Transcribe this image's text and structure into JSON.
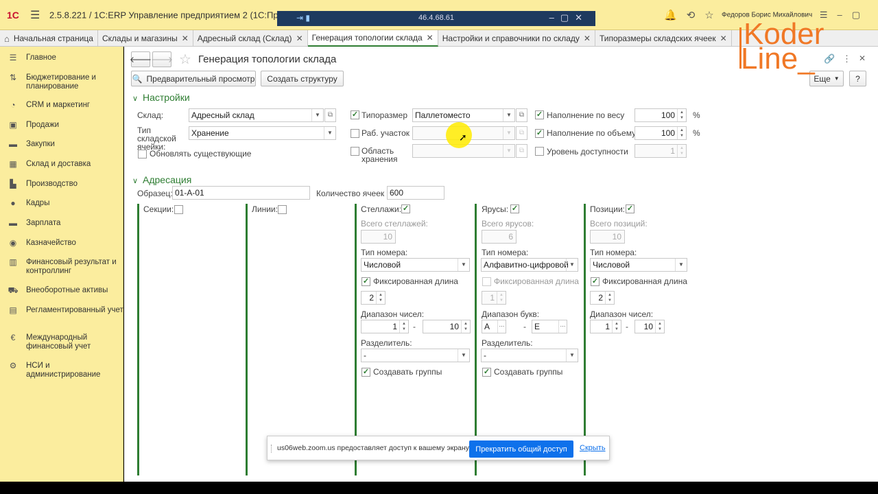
{
  "titlebar": {
    "logo": "1С",
    "title": "2.5.8.221 / 1С:ERP Управление предприятием 2  (1С:Предприятие)",
    "user": "Федоров Борис Михайлович",
    "zoom_ip": "46.4.68.61"
  },
  "tabs": [
    {
      "label": "Начальная страница"
    },
    {
      "label": "Склады и магазины"
    },
    {
      "label": "Адресный склад (Склад)"
    },
    {
      "label": "Генерация топологии склада"
    },
    {
      "label": "Настройки и справочники по складу"
    },
    {
      "label": "Типоразмеры складских ячеек"
    }
  ],
  "sidebar": {
    "items": [
      {
        "label": "Главное",
        "icon": "menu-icon"
      },
      {
        "label": "Бюджетирование и планирование",
        "icon": "budget-icon"
      },
      {
        "label": "CRM и маркетинг",
        "icon": "crm-icon"
      },
      {
        "label": "Продажи",
        "icon": "sales-icon"
      },
      {
        "label": "Закупки",
        "icon": "cart-icon"
      },
      {
        "label": "Склад и доставка",
        "icon": "warehouse-icon"
      },
      {
        "label": "Производство",
        "icon": "factory-icon"
      },
      {
        "label": "Кадры",
        "icon": "person-icon"
      },
      {
        "label": "Зарплата",
        "icon": "salary-icon"
      },
      {
        "label": "Казначейство",
        "icon": "treasury-icon"
      },
      {
        "label": "Финансовый результат и контроллинг",
        "icon": "chart-icon"
      },
      {
        "label": "Внеоборотные активы",
        "icon": "car-icon"
      },
      {
        "label": "Регламентированный учет",
        "icon": "document-icon"
      },
      {
        "label": "Международный финансовый учет",
        "icon": "currency-icon"
      },
      {
        "label": "НСИ и администрирование",
        "icon": "gear-icon"
      }
    ]
  },
  "form": {
    "title": "Генерация топологии склада",
    "preview_btn": "Предварительный просмотр",
    "create_btn": "Создать структуру",
    "more_btn": "Еще",
    "help_btn": "?",
    "settings_section": "Настройки",
    "warehouse_label": "Склад:",
    "warehouse_value": "Адресный склад",
    "cell_type_label": "Тип складской ячейки:",
    "cell_type_value": "Хранение",
    "update_existing_label": "Обновлять существующие",
    "size_label": "Типоразмер",
    "size_value": "Паллетоместо",
    "work_area_label": "Раб. участок",
    "storage_area_label": "Область хранения",
    "fill_weight_label": "Наполнение по весу",
    "fill_weight_value": "100",
    "fill_volume_label": "Наполнение по объему",
    "fill_volume_value": "100",
    "access_level_label": "Уровень доступности",
    "access_level_value": "1",
    "percent": "%",
    "addressing_section": "Адресация",
    "sample_label": "Образец:",
    "sample_value": "01-А-01",
    "cell_count_label": "Количество ячеек :",
    "cell_count_value": "600"
  },
  "columns": {
    "sections": {
      "label": "Секции:"
    },
    "lines": {
      "label": "Линии:"
    },
    "racks": {
      "label": "Стеллажи:",
      "total_label": "Всего стеллажей:",
      "total_value": "10",
      "num_type_label": "Тип номера:",
      "num_type_value": "Числовой",
      "fixed_len_label": "Фиксированная длина",
      "fixed_len_value": "2",
      "range_label": "Диапазон чисел:",
      "range_from": "1",
      "range_to": "10",
      "sep_label": "Разделитель:",
      "sep_value": "-",
      "groups_label": "Создавать группы"
    },
    "tiers": {
      "label": "Ярусы:",
      "total_label": "Всего ярусов:",
      "total_value": "6",
      "num_type_label": "Тип номера:",
      "num_type_value": "Алфавитно-цифровой",
      "fixed_len_label": "Фиксированная длина",
      "fixed_len_value": "1",
      "range_label": "Диапазон букв:",
      "range_from": "А",
      "range_to": "Е",
      "sep_label": "Разделитель:",
      "sep_value": "-",
      "groups_label": "Создавать группы"
    },
    "positions": {
      "label": "Позиции:",
      "total_label": "Всего позиций:",
      "total_value": "10",
      "num_type_label": "Тип номера:",
      "num_type_value": "Числовой",
      "fixed_len_label": "Фиксированная длина",
      "fixed_len_value": "2",
      "range_label": "Диапазон чисел:",
      "range_from": "1",
      "range_to": "10"
    },
    "dash": "-"
  },
  "notification": {
    "text": "us06web.zoom.us предоставляет доступ к вашему экрану.",
    "stop_btn": "Прекратить общий доступ",
    "hide_link": "Скрыть"
  },
  "watermark": {
    "line1": "Koder",
    "line2": "Line_"
  },
  "colors": {
    "accent": "#2e7d32",
    "sidebar_bg": "#fbed9e",
    "zoom_blue": "#0e71eb",
    "watermark": "#f07826"
  }
}
